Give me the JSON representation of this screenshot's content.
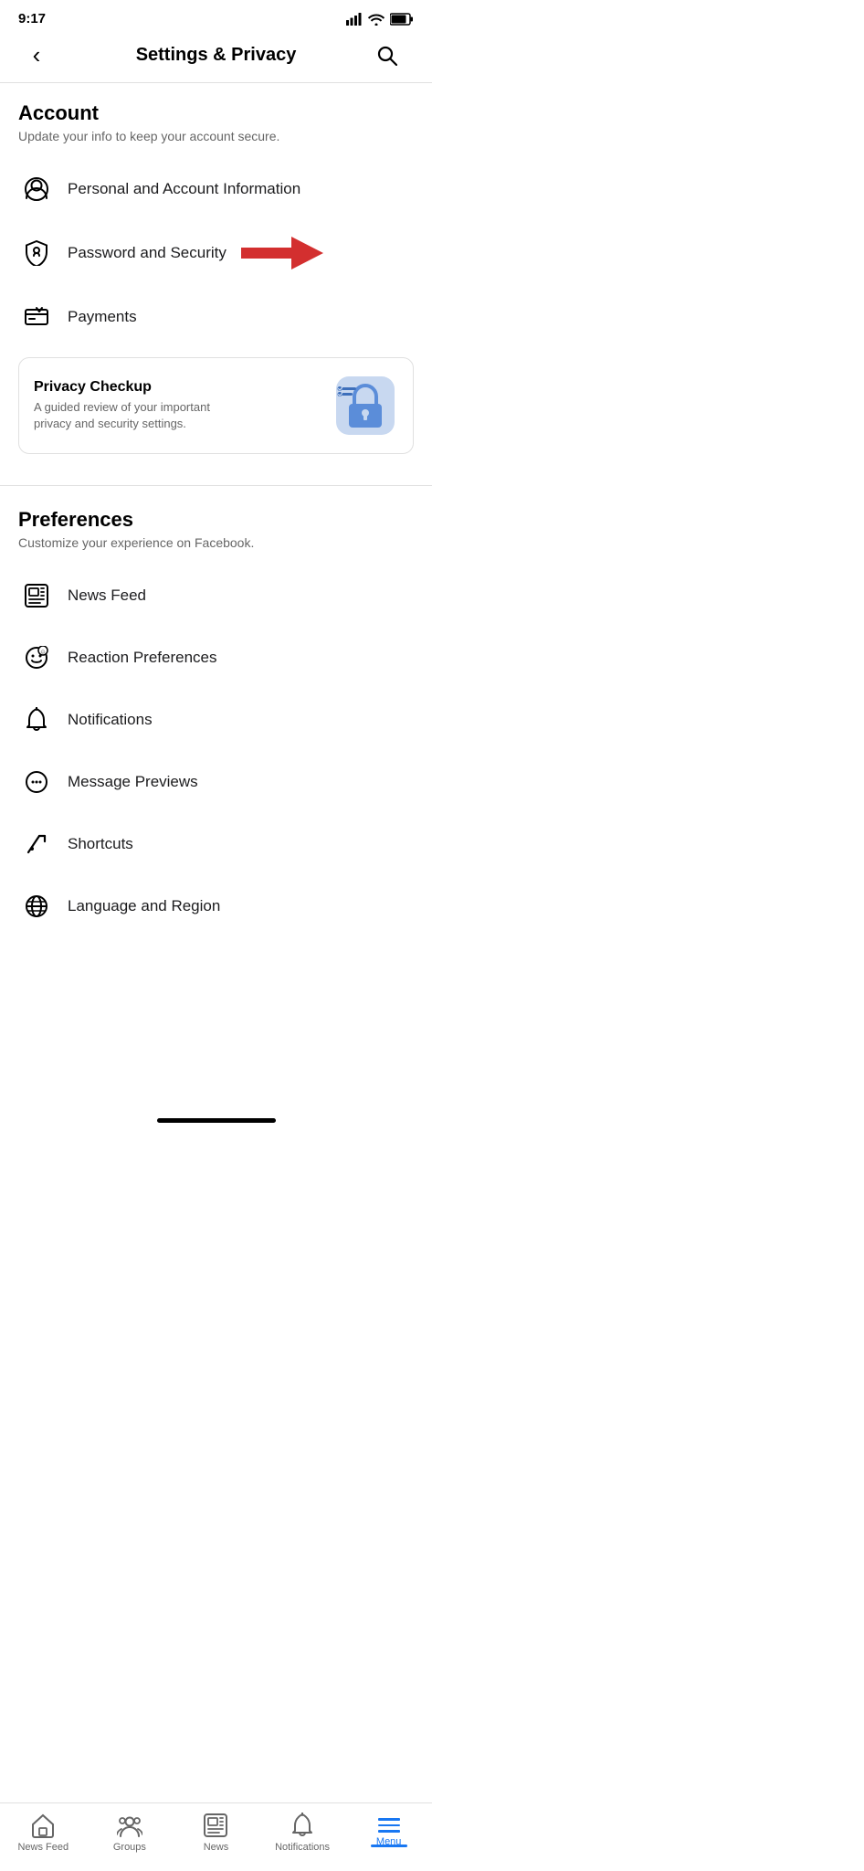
{
  "statusBar": {
    "time": "9:17",
    "signal": "signal-icon",
    "wifi": "wifi-icon",
    "battery": "battery-icon"
  },
  "header": {
    "backLabel": "‹",
    "title": "Settings & Privacy",
    "searchLabel": "🔍"
  },
  "accountSection": {
    "title": "Account",
    "subtitle": "Update your info to keep your account secure.",
    "items": [
      {
        "icon": "person-icon",
        "label": "Personal and Account Information"
      },
      {
        "icon": "shield-icon",
        "label": "Password and Security",
        "hasArrow": true
      },
      {
        "icon": "payments-icon",
        "label": "Payments"
      }
    ]
  },
  "privacyCard": {
    "title": "Privacy Checkup",
    "subtitle": "A guided review of your important privacy and security settings."
  },
  "preferencesSection": {
    "title": "Preferences",
    "subtitle": "Customize your experience on Facebook.",
    "items": [
      {
        "icon": "news-feed-icon",
        "label": "News Feed"
      },
      {
        "icon": "reaction-icon",
        "label": "Reaction Preferences"
      },
      {
        "icon": "bell-icon",
        "label": "Notifications"
      },
      {
        "icon": "message-icon",
        "label": "Message Previews"
      },
      {
        "icon": "shortcut-icon",
        "label": "Shortcuts"
      },
      {
        "icon": "globe-icon",
        "label": "Language and Region"
      }
    ]
  },
  "bottomNav": {
    "items": [
      {
        "icon": "home-icon",
        "label": "News Feed",
        "active": false
      },
      {
        "icon": "groups-icon",
        "label": "Groups",
        "active": false
      },
      {
        "icon": "news-icon",
        "label": "News",
        "active": false
      },
      {
        "icon": "notifications-icon",
        "label": "Notifications",
        "active": false
      },
      {
        "icon": "menu-icon",
        "label": "Menu",
        "active": true
      }
    ]
  }
}
